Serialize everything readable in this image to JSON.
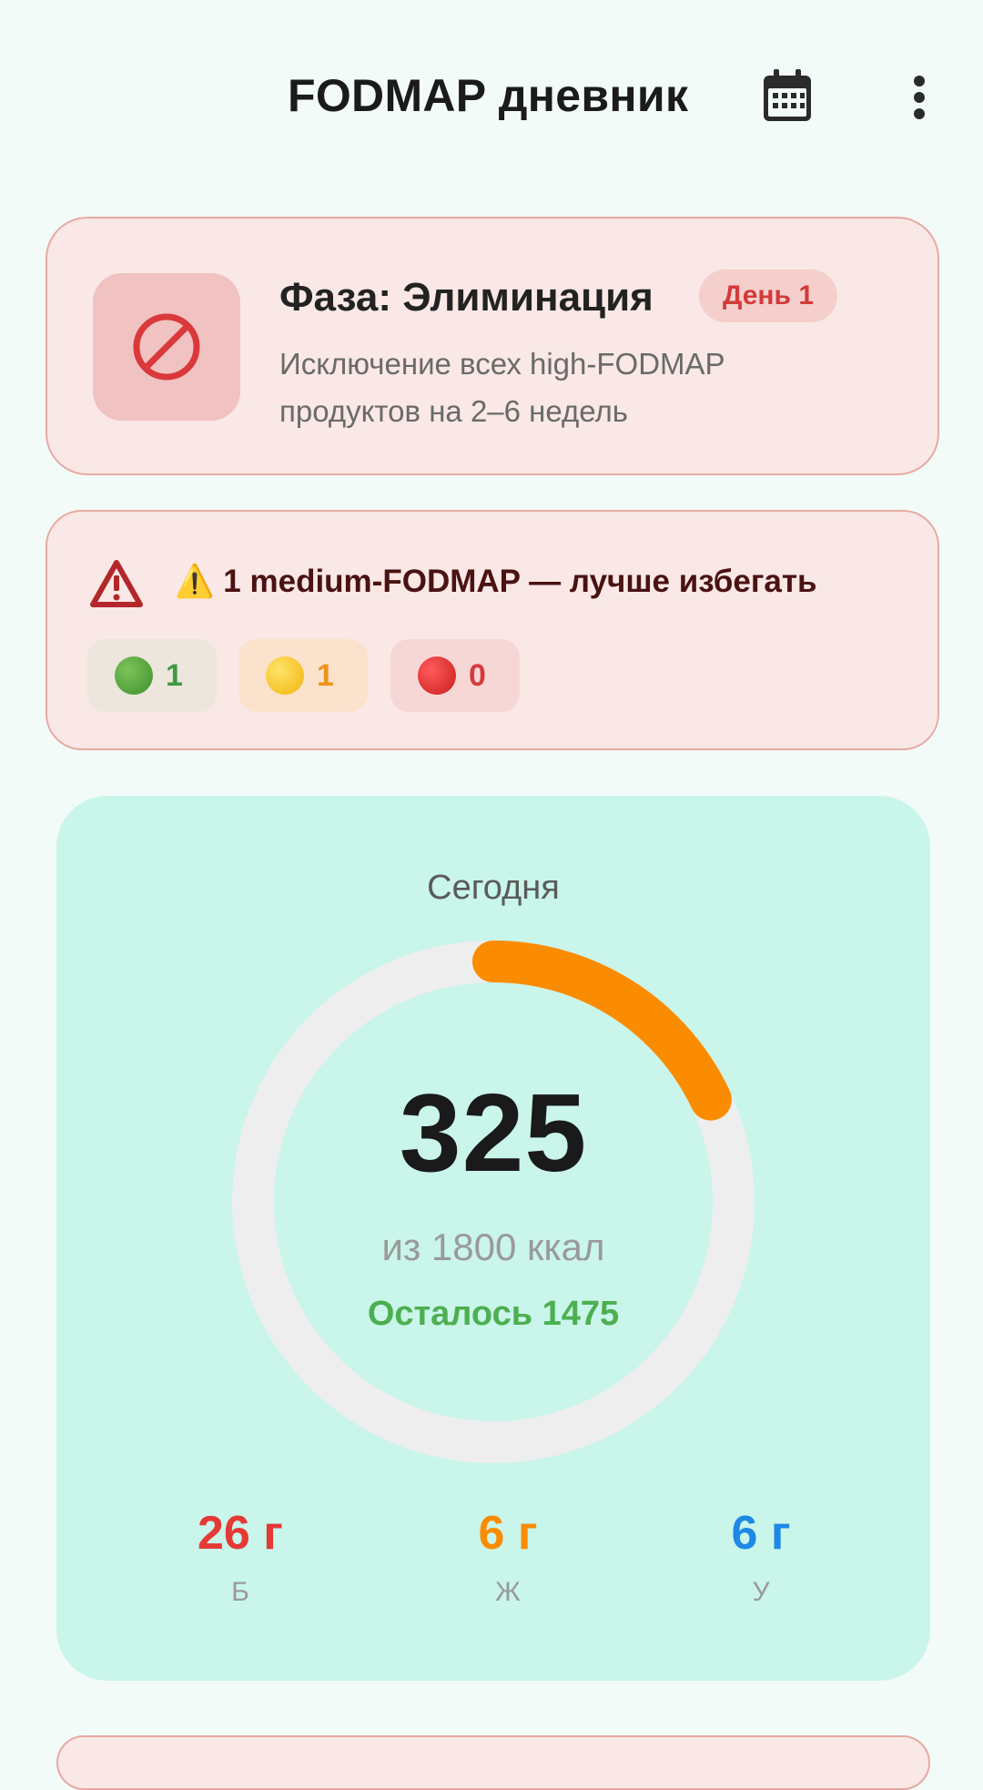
{
  "header": {
    "title": "FODMAP дневник",
    "calendar_icon": "calendar-icon",
    "more_icon": "more-vert-icon"
  },
  "phase": {
    "icon": "block-icon",
    "title": "Фаза: Элиминация",
    "day_badge": "День 1",
    "description": "Исключение всех high-FODMAP продуктов на 2–6 недель"
  },
  "warning": {
    "icon": "warning-triangle-icon",
    "text": "⚠️ 1 medium-FODMAP — лучше избегать",
    "counts": [
      {
        "color": "green",
        "value": "1"
      },
      {
        "color": "yellow",
        "value": "1"
      },
      {
        "color": "red",
        "value": "0"
      }
    ]
  },
  "today": {
    "label": "Сегодня",
    "calories": "325",
    "of_goal": "из 1800 ккал",
    "remaining": "Осталось 1475",
    "progress_fraction": 0.18,
    "macros": [
      {
        "value": "26 г",
        "label": "Б"
      },
      {
        "value": "6 г",
        "label": "Ж"
      },
      {
        "value": "6 г",
        "label": "У"
      }
    ]
  },
  "colors": {
    "background": "#f3fbf8",
    "accent_ring": "#fb8c00",
    "ring_track": "#eeeeee",
    "card_today": "#c9f5ea",
    "card_warning": "#f9e8e5"
  }
}
